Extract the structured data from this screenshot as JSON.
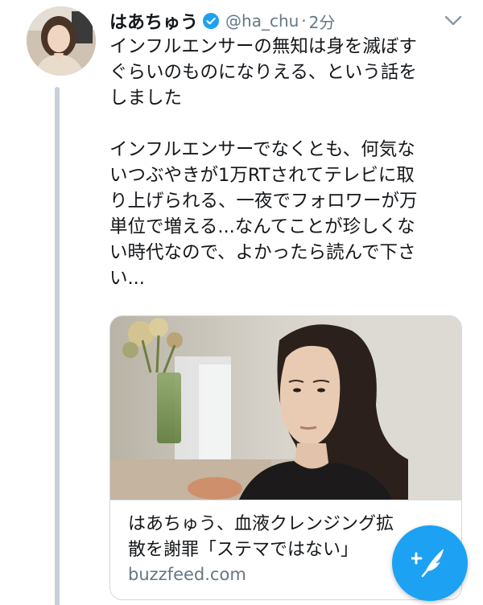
{
  "tweet": {
    "display_name": "はあちゅう",
    "verified_icon": "verified-badge-icon",
    "handle": "@ha_chu",
    "separator": "·",
    "timestamp": "2分",
    "caret_icon": "chevron-down-icon",
    "text_lines": [
      "インフルエンサーの無知は身を滅ぼす",
      "ぐらいのものになりえる、という話を",
      "しました",
      "",
      "インフルエンサーでなくとも、何気な",
      "いつぶやきが1万RTされてテレビに取",
      "り上げられる、一夜でフォロワーが万",
      "単位で増える...なんてことが珍しくな",
      "い時代なので、よかったら読んで下さ",
      "い..."
    ]
  },
  "card": {
    "title_lines": [
      "はあちゅう、血液クレンジング拡",
      "散を謝罪「ステマではない」"
    ],
    "domain": "buzzfeed.com"
  },
  "compose_button": {
    "icon": "compose-feather-icon"
  },
  "colors": {
    "accent": "#1da1f2",
    "secondary_text": "#657786",
    "thread_line": "#c7d0d8"
  }
}
